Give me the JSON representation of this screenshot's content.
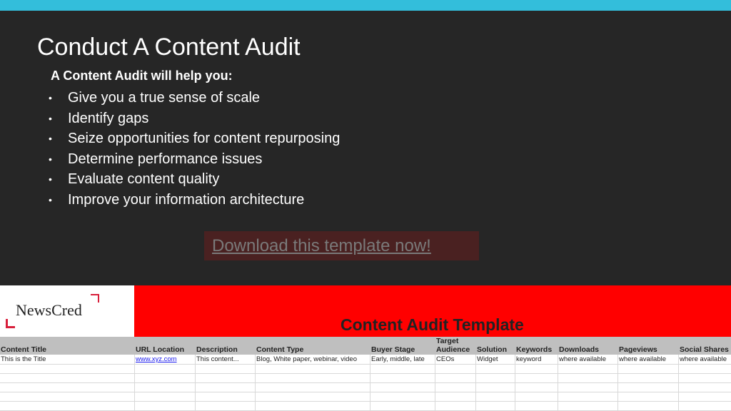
{
  "slide": {
    "title": "Conduct A Content Audit",
    "intro": "A Content Audit will help you:",
    "bullet_glyph": "•",
    "bullets": [
      "Give you a true sense of scale",
      "Identify gaps",
      "Seize opportunities for content repurposing",
      "Determine performance issues",
      "Evaluate content quality",
      "Improve your information architecture"
    ],
    "download_link": "Download this template now!"
  },
  "sheet": {
    "logo": "NewsCred",
    "title": "Content Audit Template",
    "columns": [
      {
        "header": "Content Title",
        "value": "This is the Title"
      },
      {
        "header": "URL Location",
        "value": "www.xyz.com"
      },
      {
        "header": "Description",
        "value": "This content..."
      },
      {
        "header": "Content Type",
        "value": "Blog, White paper, webinar, video"
      },
      {
        "header": "Buyer Stage",
        "value": "Early, middle, late"
      },
      {
        "header_line1": "Target",
        "header_line2": "Audience",
        "value": "CEOs"
      },
      {
        "header": "Solution",
        "value": "Widget"
      },
      {
        "header": "Keywords",
        "value": "keyword"
      },
      {
        "header": "Downloads",
        "value": "where available"
      },
      {
        "header": "Pageviews",
        "value": "where available"
      },
      {
        "header": "Social Shares",
        "value": "where available"
      }
    ]
  },
  "colors": {
    "accent_bar": "#33bedb",
    "slide_bg": "#262626",
    "sheet_red": "#ff0000",
    "logo_accent": "#d81f3b"
  }
}
